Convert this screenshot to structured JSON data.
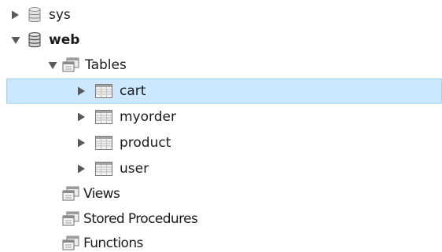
{
  "navigator": {
    "colors": {
      "selection_background": "#cce8ff",
      "selection_border": "#99d1ff",
      "expander": "#595959"
    },
    "schemas": [
      {
        "name": "sys",
        "expanded": false,
        "active": false,
        "icon": "database-icon"
      },
      {
        "name": "web",
        "expanded": true,
        "active": true,
        "icon": "database-icon",
        "groups": {
          "tables": {
            "label": "Tables",
            "expanded": true,
            "icon": "folder-tables-icon",
            "items": [
              {
                "name": "cart",
                "selected": true,
                "icon": "table-icon"
              },
              {
                "name": "myorder",
                "selected": false,
                "icon": "table-icon"
              },
              {
                "name": "product",
                "selected": false,
                "icon": "table-icon"
              },
              {
                "name": "user",
                "selected": false,
                "icon": "table-icon"
              }
            ]
          },
          "views": {
            "label": "Views",
            "icon": "folder-views-icon"
          },
          "stored_procedures": {
            "label": "Stored Procedures",
            "icon": "folder-procedures-icon"
          },
          "functions": {
            "label": "Functions",
            "icon": "folder-functions-icon"
          }
        }
      }
    ]
  }
}
